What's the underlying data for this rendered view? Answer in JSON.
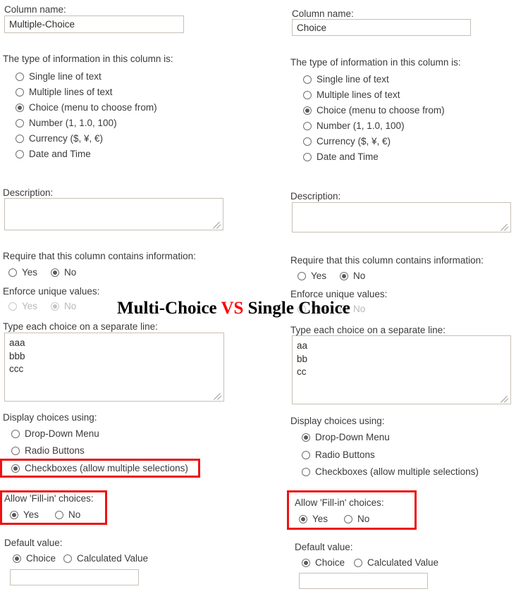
{
  "overlay": {
    "text_before": "Multi-Choice ",
    "vs": "VS",
    "text_after": " Single Choice"
  },
  "labels": {
    "column_name": "Column name:",
    "type_of_information": "The type of information in this column is:",
    "description": "Description:",
    "require_info": "Require that this column contains information:",
    "enforce_unique": "Enforce unique values:",
    "type_each_choice": "Type each choice on a separate line:",
    "display_choices": "Display choices using:",
    "allow_fill_in": "Allow 'Fill-in' choices:",
    "default_value": "Default value:",
    "yes": "Yes",
    "no": "No",
    "choice": "Choice",
    "calculated_value": "Calculated Value"
  },
  "type_options": [
    "Single line of text",
    "Multiple lines of text",
    "Choice (menu to choose from)",
    "Number (1, 1.0, 100)",
    "Currency ($, ¥, €)",
    "Date and Time"
  ],
  "display_options": [
    "Drop-Down Menu",
    "Radio Buttons",
    "Checkboxes (allow multiple selections)"
  ],
  "left": {
    "column_name_value": "Multiple-Choice",
    "description_value": "",
    "type_selected_index": 2,
    "require_selected": "No",
    "enforce_selected": "No",
    "choices_value": "aaa\nbbb\nccc",
    "display_selected_index": 2,
    "fill_in_selected": "Yes",
    "default_selected": "Choice",
    "default_value": ""
  },
  "right": {
    "column_name_value": "Choice",
    "description_value": "",
    "type_selected_index": 2,
    "require_selected": "No",
    "enforce_selected": "No",
    "choices_value": "aa\nbb\ncc",
    "display_selected_index": 0,
    "fill_in_selected": "Yes",
    "default_selected": "Choice",
    "default_value": ""
  },
  "colors": {
    "highlight": "#ee1111",
    "vs_red": "#ff0000",
    "field_border": "#c8bfb6"
  }
}
